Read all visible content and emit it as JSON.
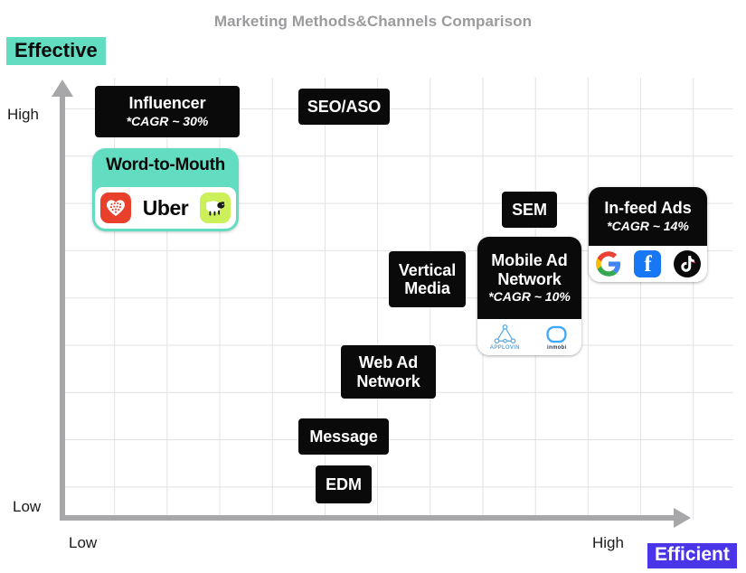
{
  "title": "Marketing Methods&Channels Comparison",
  "badges": {
    "effective": {
      "label": "Effective",
      "color": "#63DDC2"
    },
    "efficient": {
      "label": "Efficient",
      "color": "#4B35E8"
    }
  },
  "axes": {
    "y": {
      "name": "Effective",
      "high": "High",
      "low": "Low"
    },
    "x": {
      "name": "Efficient",
      "low": "Low",
      "high": "High"
    }
  },
  "chart_data": {
    "type": "scatter",
    "title": "Marketing Methods&Channels Comparison",
    "xlabel": "Efficient",
    "ylabel": "Effective",
    "xlim": [
      "Low",
      "High"
    ],
    "ylim": [
      "Low",
      "High"
    ],
    "grid": true,
    "legend": "none",
    "items": [
      {
        "id": "influencer",
        "label": "Influencer",
        "sub": "*CAGR ~ 30%",
        "x": 0.08,
        "y": 0.95,
        "style": "black",
        "logos": []
      },
      {
        "id": "word-to-mouth",
        "label": "Word-to-Mouth",
        "sub": "",
        "x": 0.08,
        "y": 0.82,
        "style": "teal",
        "logos": [
          "xiaohongshu-icon",
          "uber-wordmark",
          "meituan-sheep-icon"
        ]
      },
      {
        "id": "seo-aso",
        "label": "SEO/ASO",
        "sub": "",
        "x": 0.42,
        "y": 0.95,
        "style": "black",
        "logos": []
      },
      {
        "id": "sem",
        "label": "SEM",
        "sub": "",
        "x": 0.71,
        "y": 0.72,
        "style": "black",
        "logos": []
      },
      {
        "id": "in-feed-ads",
        "label": "In-feed Ads",
        "sub": "*CAGR ~ 14%",
        "x": 0.88,
        "y": 0.7,
        "style": "black-combo",
        "logos": [
          "google-icon",
          "facebook-icon",
          "tiktok-icon"
        ]
      },
      {
        "id": "vertical-media",
        "label": "Vertical Media",
        "sub": "",
        "x": 0.55,
        "y": 0.56,
        "style": "black",
        "logos": []
      },
      {
        "id": "mobile-ad-network",
        "label": "Mobile Ad Network",
        "sub": "*CAGR ~ 10%",
        "x": 0.68,
        "y": 0.52,
        "style": "black-combo",
        "logos": [
          "applovin-icon",
          "inmobi-icon"
        ]
      },
      {
        "id": "web-ad-network",
        "label": "Web Ad Network",
        "sub": "",
        "x": 0.47,
        "y": 0.35,
        "style": "black",
        "logos": []
      },
      {
        "id": "message",
        "label": "Message",
        "sub": "",
        "x": 0.4,
        "y": 0.19,
        "style": "black",
        "logos": []
      },
      {
        "id": "edm",
        "label": "EDM",
        "sub": "",
        "x": 0.42,
        "y": 0.09,
        "style": "black",
        "logos": []
      }
    ]
  },
  "cards": {
    "influencer": {
      "title": "Influencer",
      "sub": "*CAGR ~ 30%"
    },
    "word_to_mouth": {
      "title": "Word-to-Mouth"
    },
    "seo_aso": {
      "title": "SEO/ASO"
    },
    "sem": {
      "title": "SEM"
    },
    "in_feed_ads": {
      "title": "In-feed Ads",
      "sub": "*CAGR ~ 14%"
    },
    "vertical_media": {
      "line1": "Vertical",
      "line2": "Media"
    },
    "mobile_ad_network": {
      "line1": "Mobile Ad",
      "line2": "Network",
      "sub": "*CAGR ~ 10%"
    },
    "web_ad_network": {
      "line1": "Web Ad",
      "line2": "Network"
    },
    "message": {
      "title": "Message"
    },
    "edm": {
      "title": "EDM"
    }
  },
  "logos": {
    "uber": "Uber",
    "applovin": "APPLOVIN",
    "inmobi": "inmobi",
    "facebook": "f"
  }
}
